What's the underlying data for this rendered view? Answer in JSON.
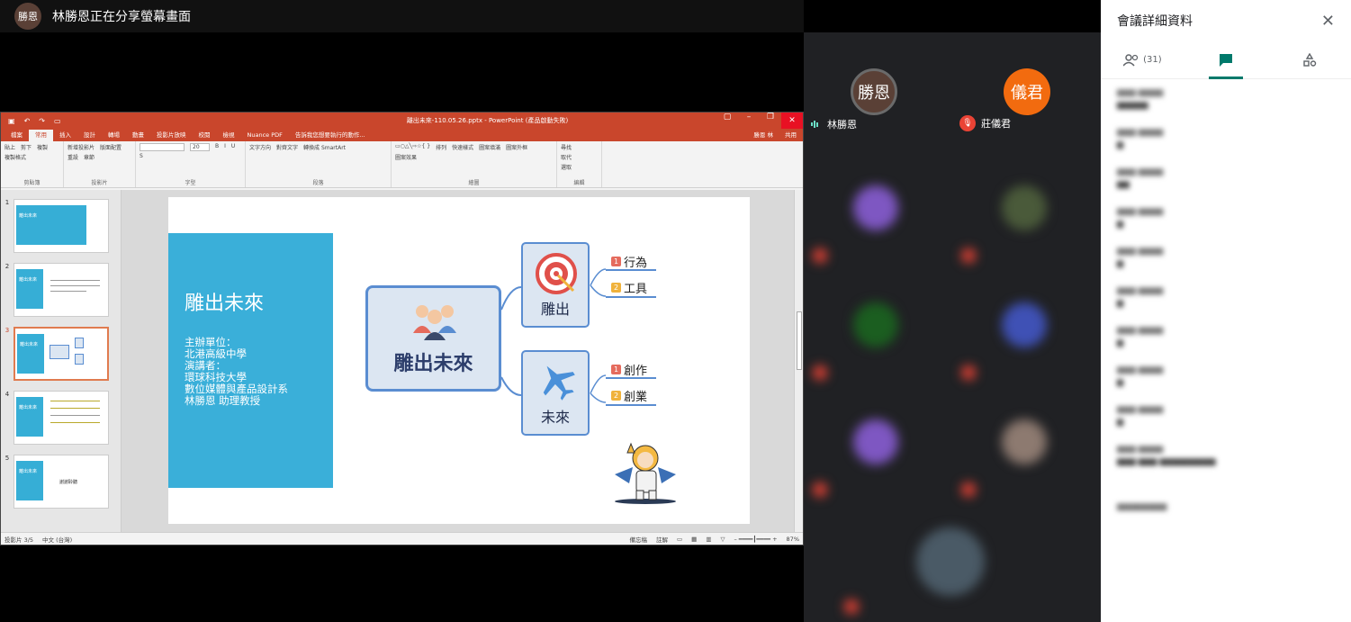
{
  "presenter": {
    "avatar": "勝恩",
    "text": "林勝恩正在分享螢幕畫面"
  },
  "ppt": {
    "window_title": "離出未來-110.05.26.pptx - PowerPoint (產品啟動失敗)",
    "tabs": [
      "檔案",
      "常用",
      "插入",
      "設計",
      "轉場",
      "動畫",
      "投影片放映",
      "校閱",
      "檢視",
      "Nuance PDF",
      "告訴我您想要執行的動作..."
    ],
    "user": "勝恩 林",
    "share": "共用",
    "ribbon_groups": [
      "剪貼簿",
      "投影片",
      "字型",
      "段落",
      "繪圖",
      "編輯"
    ],
    "ribbon": {
      "paste": "貼上",
      "cut": "剪下",
      "copy": "複製",
      "format_painter": "複製格式",
      "new_slide": "新增投影片",
      "layout": "版面配置",
      "reset": "重設",
      "section": "章節",
      "font_size": "20",
      "text_direction": "文字方向",
      "align_text": "對齊文字",
      "smartart": "轉換成 SmartArt",
      "arrange": "排列",
      "quick_styles": "快速樣式",
      "shape_fill": "圖案填滿",
      "shape_outline": "圖案外框",
      "shape_effects": "圖案效果",
      "find": "尋找",
      "replace": "取代",
      "select": "選取"
    },
    "thumbnails": [
      {
        "num": "1",
        "title": "離出未來"
      },
      {
        "num": "2",
        "title": "離出未來"
      },
      {
        "num": "3",
        "title": "離出未來"
      },
      {
        "num": "4",
        "title": "離出未來"
      },
      {
        "num": "5",
        "title": "離出未來",
        "center": "謝謝聆聽"
      }
    ],
    "slide": {
      "title": "雕出未來",
      "info": [
        "主辦單位：",
        "北港高級中學",
        "演講者：",
        "環球科技大學",
        "數位媒體與產品設計系",
        "林勝恩 助理教授"
      ],
      "center_label": "雕出未來",
      "node1": "雕出",
      "node2": "未來",
      "leaves": [
        {
          "num": "1",
          "label": "行為"
        },
        {
          "num": "2",
          "label": "工具"
        },
        {
          "num": "1",
          "label": "創作"
        },
        {
          "num": "2",
          "label": "創業"
        }
      ]
    },
    "status": {
      "slide_pos": "投影片 3/5",
      "lang": "中文 (台灣)",
      "notes": "備忘稿",
      "comments": "註解",
      "zoom": "87%"
    }
  },
  "videos": {
    "tiles": [
      {
        "initials": "勝恩",
        "name": "林勝恩",
        "color": "#5a4036",
        "mic": "on"
      },
      {
        "initials": "儀君",
        "name": "莊儀君",
        "color": "#f26b0f",
        "mic": "off"
      }
    ]
  },
  "panel": {
    "title": "會議詳細資料",
    "people_count": "(31)",
    "colors": {
      "accent": "#00796b"
    }
  }
}
